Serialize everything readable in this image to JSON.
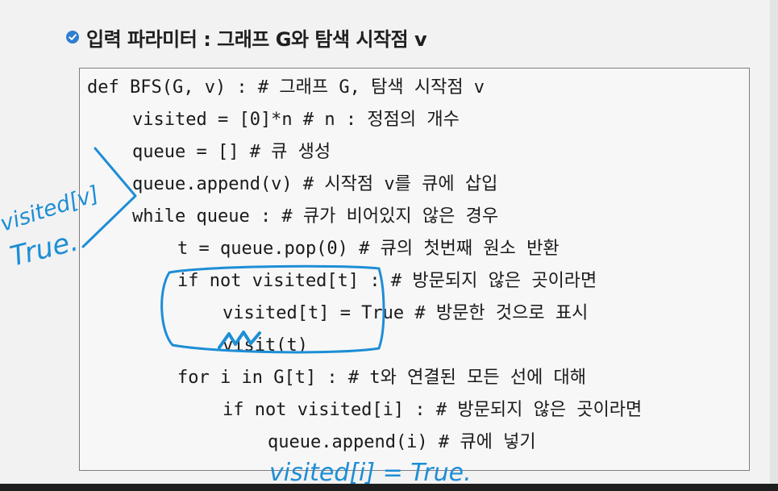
{
  "slide": {
    "title": "입력 파라미터 : 그래프 G와 탐색 시작점 v"
  },
  "code": {
    "lines": [
      "def BFS(G, v) : # 그래프 G, 탐색 시작점 v",
      "visited = [0]*n # n : 정점의 개수",
      "queue = [] # 큐 생성",
      "queue.append(v) # 시작점 v를 큐에 삽입",
      "while queue : # 큐가 비어있지 않은 경우",
      "t = queue.pop(0) # 큐의 첫번째 원소 반환",
      "if not visited[t] : # 방문되지 않은 곳이라면",
      "visited[t] = True # 방문한 것으로 표시",
      "visit(t)",
      "for i in G[t] : # t와 연결된 모든 선에 대해",
      "if not visited[i] : # 방문되지 않은 곳이라면",
      "queue.append(i) # 큐에 넣기"
    ]
  },
  "annotations": {
    "left_note_line1": "visited[v]",
    "left_note_line2": "True.",
    "bottom_note": "visited[i] = True."
  },
  "colors": {
    "ink": "#1d8ed6",
    "check_icon": "#2f7fd0"
  },
  "icons": {
    "bullet": "check-circle-icon"
  }
}
